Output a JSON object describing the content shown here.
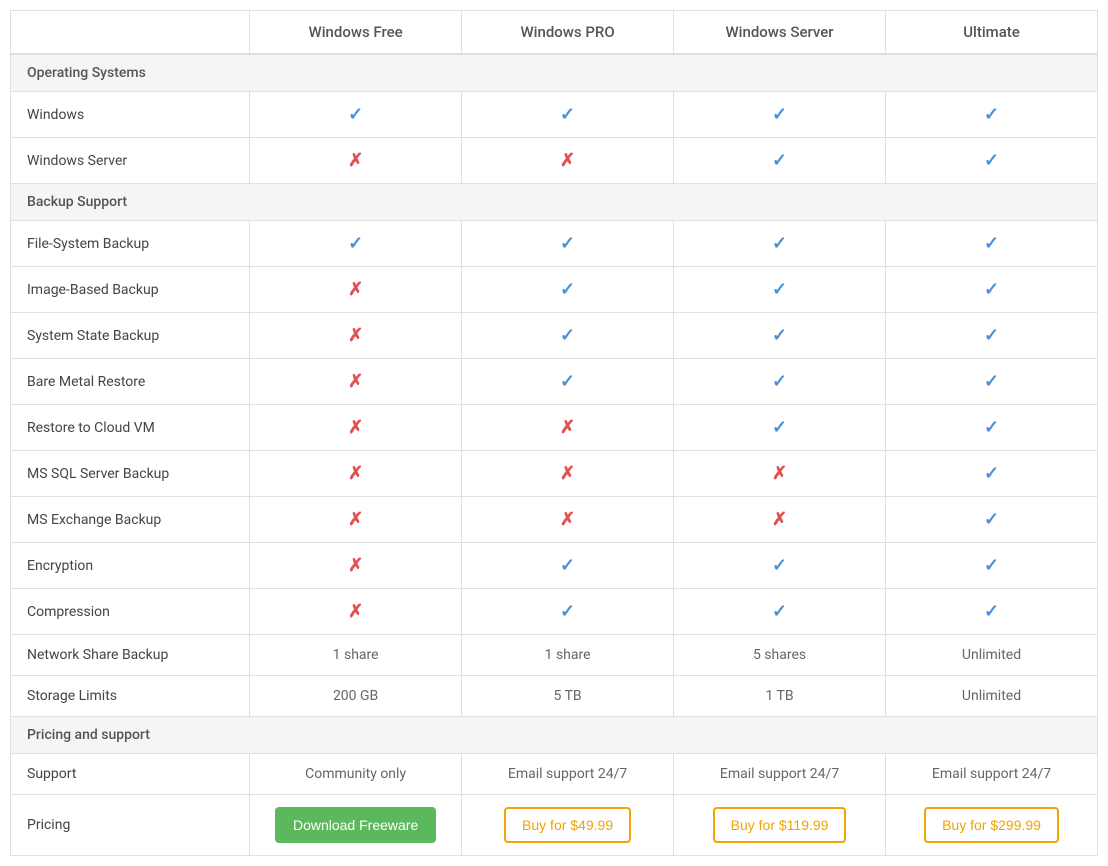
{
  "header": {
    "col1": "",
    "col2": "Windows Free",
    "col3": "Windows PRO",
    "col4": "Windows Server",
    "col5": "Ultimate"
  },
  "sections": [
    {
      "type": "section-header",
      "label": "Operating Systems"
    },
    {
      "type": "row",
      "label": "Windows",
      "col2": "check",
      "col3": "check",
      "col4": "check",
      "col5": "check"
    },
    {
      "type": "row",
      "label": "Windows Server",
      "col2": "cross",
      "col3": "cross",
      "col4": "check",
      "col5": "check"
    },
    {
      "type": "section-header",
      "label": "Backup Support"
    },
    {
      "type": "row",
      "label": "File-System Backup",
      "col2": "check",
      "col3": "check",
      "col4": "check",
      "col5": "check"
    },
    {
      "type": "row",
      "label": "Image-Based Backup",
      "col2": "cross",
      "col3": "check",
      "col4": "check",
      "col5": "check"
    },
    {
      "type": "row",
      "label": "System State Backup",
      "col2": "cross",
      "col3": "check",
      "col4": "check",
      "col5": "check"
    },
    {
      "type": "row",
      "label": "Bare Metal Restore",
      "col2": "cross",
      "col3": "check",
      "col4": "check",
      "col5": "check"
    },
    {
      "type": "row",
      "label": "Restore to Cloud VM",
      "col2": "cross",
      "col3": "cross",
      "col4": "check",
      "col5": "check"
    },
    {
      "type": "row",
      "label": "MS SQL Server Backup",
      "col2": "cross",
      "col3": "cross",
      "col4": "cross",
      "col5": "check"
    },
    {
      "type": "row",
      "label": "MS Exchange Backup",
      "col2": "cross",
      "col3": "cross",
      "col4": "cross",
      "col5": "check"
    },
    {
      "type": "row",
      "label": "Encryption",
      "col2": "cross",
      "col3": "check",
      "col4": "check",
      "col5": "check"
    },
    {
      "type": "row",
      "label": "Compression",
      "col2": "cross",
      "col3": "check",
      "col4": "check",
      "col5": "check"
    },
    {
      "type": "row",
      "label": "Network Share Backup",
      "col2": "1 share",
      "col3": "1 share",
      "col4": "5 shares",
      "col5": "Unlimited"
    },
    {
      "type": "row",
      "label": "Storage Limits",
      "col2": "200 GB",
      "col3": "5 TB",
      "col4": "1 TB",
      "col5": "Unlimited"
    },
    {
      "type": "section-header",
      "label": "Pricing and support"
    },
    {
      "type": "row",
      "label": "Support",
      "col2": "Community only",
      "col3": "Email support 24/7",
      "col4": "Email support 24/7",
      "col5": "Email support 24/7"
    },
    {
      "type": "pricing-row",
      "label": "Pricing",
      "col2": {
        "type": "btn-green",
        "text": "Download Freeware"
      },
      "col3": {
        "type": "btn-orange",
        "text": "Buy for $49.99"
      },
      "col4": {
        "type": "btn-orange",
        "text": "Buy for $119.99"
      },
      "col5": {
        "type": "btn-orange",
        "text": "Buy for $299.99"
      }
    }
  ]
}
